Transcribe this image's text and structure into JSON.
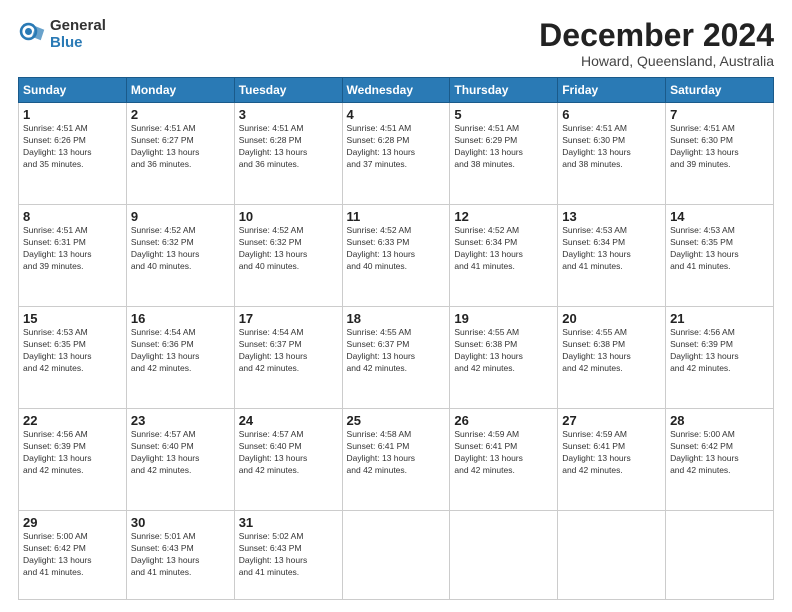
{
  "logo": {
    "general": "General",
    "blue": "Blue"
  },
  "header": {
    "month": "December 2024",
    "location": "Howard, Queensland, Australia"
  },
  "days_of_week": [
    "Sunday",
    "Monday",
    "Tuesday",
    "Wednesday",
    "Thursday",
    "Friday",
    "Saturday"
  ],
  "weeks": [
    [
      {
        "day": "1",
        "sunrise": "4:51 AM",
        "sunset": "6:26 PM",
        "daylight": "13 hours and 35 minutes."
      },
      {
        "day": "2",
        "sunrise": "4:51 AM",
        "sunset": "6:27 PM",
        "daylight": "13 hours and 36 minutes."
      },
      {
        "day": "3",
        "sunrise": "4:51 AM",
        "sunset": "6:28 PM",
        "daylight": "13 hours and 36 minutes."
      },
      {
        "day": "4",
        "sunrise": "4:51 AM",
        "sunset": "6:28 PM",
        "daylight": "13 hours and 37 minutes."
      },
      {
        "day": "5",
        "sunrise": "4:51 AM",
        "sunset": "6:29 PM",
        "daylight": "13 hours and 38 minutes."
      },
      {
        "day": "6",
        "sunrise": "4:51 AM",
        "sunset": "6:30 PM",
        "daylight": "13 hours and 38 minutes."
      },
      {
        "day": "7",
        "sunrise": "4:51 AM",
        "sunset": "6:30 PM",
        "daylight": "13 hours and 39 minutes."
      }
    ],
    [
      {
        "day": "8",
        "sunrise": "4:51 AM",
        "sunset": "6:31 PM",
        "daylight": "13 hours and 39 minutes."
      },
      {
        "day": "9",
        "sunrise": "4:52 AM",
        "sunset": "6:32 PM",
        "daylight": "13 hours and 40 minutes."
      },
      {
        "day": "10",
        "sunrise": "4:52 AM",
        "sunset": "6:32 PM",
        "daylight": "13 hours and 40 minutes."
      },
      {
        "day": "11",
        "sunrise": "4:52 AM",
        "sunset": "6:33 PM",
        "daylight": "13 hours and 40 minutes."
      },
      {
        "day": "12",
        "sunrise": "4:52 AM",
        "sunset": "6:34 PM",
        "daylight": "13 hours and 41 minutes."
      },
      {
        "day": "13",
        "sunrise": "4:53 AM",
        "sunset": "6:34 PM",
        "daylight": "13 hours and 41 minutes."
      },
      {
        "day": "14",
        "sunrise": "4:53 AM",
        "sunset": "6:35 PM",
        "daylight": "13 hours and 41 minutes."
      }
    ],
    [
      {
        "day": "15",
        "sunrise": "4:53 AM",
        "sunset": "6:35 PM",
        "daylight": "13 hours and 42 minutes."
      },
      {
        "day": "16",
        "sunrise": "4:54 AM",
        "sunset": "6:36 PM",
        "daylight": "13 hours and 42 minutes."
      },
      {
        "day": "17",
        "sunrise": "4:54 AM",
        "sunset": "6:37 PM",
        "daylight": "13 hours and 42 minutes."
      },
      {
        "day": "18",
        "sunrise": "4:55 AM",
        "sunset": "6:37 PM",
        "daylight": "13 hours and 42 minutes."
      },
      {
        "day": "19",
        "sunrise": "4:55 AM",
        "sunset": "6:38 PM",
        "daylight": "13 hours and 42 minutes."
      },
      {
        "day": "20",
        "sunrise": "4:55 AM",
        "sunset": "6:38 PM",
        "daylight": "13 hours and 42 minutes."
      },
      {
        "day": "21",
        "sunrise": "4:56 AM",
        "sunset": "6:39 PM",
        "daylight": "13 hours and 42 minutes."
      }
    ],
    [
      {
        "day": "22",
        "sunrise": "4:56 AM",
        "sunset": "6:39 PM",
        "daylight": "13 hours and 42 minutes."
      },
      {
        "day": "23",
        "sunrise": "4:57 AM",
        "sunset": "6:40 PM",
        "daylight": "13 hours and 42 minutes."
      },
      {
        "day": "24",
        "sunrise": "4:57 AM",
        "sunset": "6:40 PM",
        "daylight": "13 hours and 42 minutes."
      },
      {
        "day": "25",
        "sunrise": "4:58 AM",
        "sunset": "6:41 PM",
        "daylight": "13 hours and 42 minutes."
      },
      {
        "day": "26",
        "sunrise": "4:59 AM",
        "sunset": "6:41 PM",
        "daylight": "13 hours and 42 minutes."
      },
      {
        "day": "27",
        "sunrise": "4:59 AM",
        "sunset": "6:41 PM",
        "daylight": "13 hours and 42 minutes."
      },
      {
        "day": "28",
        "sunrise": "5:00 AM",
        "sunset": "6:42 PM",
        "daylight": "13 hours and 42 minutes."
      }
    ],
    [
      {
        "day": "29",
        "sunrise": "5:00 AM",
        "sunset": "6:42 PM",
        "daylight": "13 hours and 41 minutes."
      },
      {
        "day": "30",
        "sunrise": "5:01 AM",
        "sunset": "6:43 PM",
        "daylight": "13 hours and 41 minutes."
      },
      {
        "day": "31",
        "sunrise": "5:02 AM",
        "sunset": "6:43 PM",
        "daylight": "13 hours and 41 minutes."
      },
      null,
      null,
      null,
      null
    ]
  ],
  "labels": {
    "sunrise": "Sunrise:",
    "sunset": "Sunset:",
    "daylight": "Daylight:"
  }
}
